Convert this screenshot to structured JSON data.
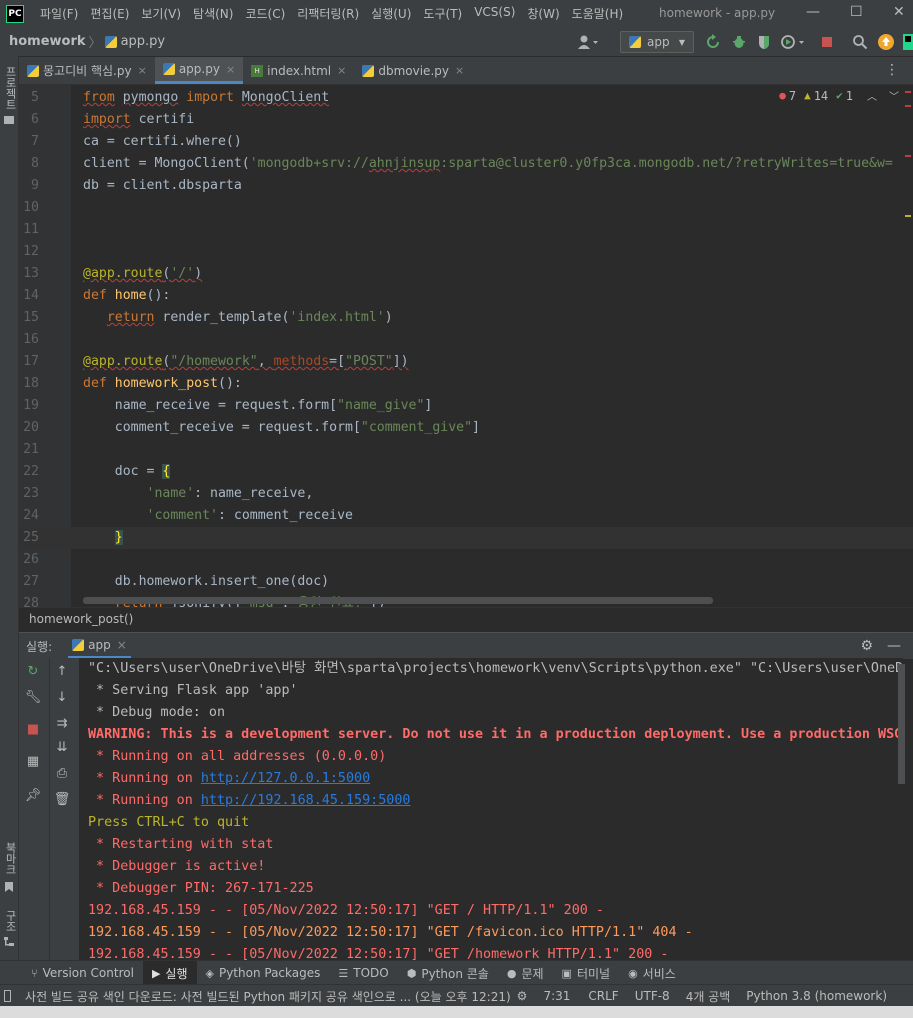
{
  "menubar": {
    "logo": "PC",
    "items": [
      "파일(F)",
      "편집(E)",
      "보기(V)",
      "탐색(N)",
      "코드(C)",
      "리팩터링(R)",
      "실행(U)",
      "도구(T)",
      "VCS(S)",
      "창(W)",
      "도움말(H)"
    ],
    "window_title": "homework - app.py",
    "minimize": "—",
    "maximize": "☐",
    "close": "✕"
  },
  "navbar": {
    "project": "homework",
    "separator": "〉",
    "file": "app.py",
    "run_config": "app",
    "run_config_arrow": "▼"
  },
  "left_stripe": {
    "project_label": "프로젝트",
    "bookmarks_label": "북마크",
    "structure_label": "구조"
  },
  "tabs": [
    {
      "label": "몽고디비 핵심.py",
      "icon": "python-file-icon",
      "active": false
    },
    {
      "label": "app.py",
      "icon": "python-file-icon",
      "active": true
    },
    {
      "label": "index.html",
      "icon": "html-file-icon",
      "active": false
    },
    {
      "label": "dbmovie.py",
      "icon": "python-file-icon",
      "active": false
    }
  ],
  "tab_close": "×",
  "tab_menu": "⋮",
  "inspections": {
    "errors": "7",
    "warnings": "14",
    "weak_warnings": "1"
  },
  "editor": {
    "lines": [
      {
        "n": "5",
        "html": "<span class='kw squig'>from</span> <span class='squig'>pymongo</span> <span class='kw'>import</span> <span class='squig'>MongoClient</span>"
      },
      {
        "n": "6",
        "html": "<span class='kw squig'>import</span> certifi"
      },
      {
        "n": "7",
        "html": "ca = certifi.where()"
      },
      {
        "n": "8",
        "html": "client = MongoClient(<span class='str'>'mongodb+srv://<span class='squig'>ahnjinsup</span>:sparta@cluster0.y0fp3ca.mongodb.net/?retryWrites=true&w=</span>"
      },
      {
        "n": "9",
        "html": "db = client.dbsparta"
      },
      {
        "n": "10",
        "html": ""
      },
      {
        "n": "11",
        "html": ""
      },
      {
        "n": "12",
        "html": ""
      },
      {
        "n": "13",
        "html": "<span class='dec squig'>@app.route</span><span class='squig'>(<span class='str'>'/'</span>)</span>"
      },
      {
        "n": "14",
        "html": "<span class='kw'>def</span> <span class='fn'>home</span>():"
      },
      {
        "n": "15",
        "html": "   <span class='kw squig'>return</span> render_template(<span class='str'>'index.html'</span>)"
      },
      {
        "n": "16",
        "html": ""
      },
      {
        "n": "17",
        "html": "<span class='dec squig'>@app.route</span><span class='squig'>(<span class='str'>\"/homework\"</span>, <span class='prm'>methods</span>=[<span class='str'>\"POST\"</span>])</span>"
      },
      {
        "n": "18",
        "html": "<span class='kw'>def</span> <span class='fn'>homework_post</span>():"
      },
      {
        "n": "19",
        "html": "    name_receive = request.form[<span class='str'>\"name_give\"</span>]"
      },
      {
        "n": "20",
        "html": "    comment_receive = request.form[<span class='str'>\"comment_give\"</span>]"
      },
      {
        "n": "21",
        "html": ""
      },
      {
        "n": "22",
        "html": "    doc = <span style='color:#ffef28;background:#3b514d'>{</span>"
      },
      {
        "n": "23",
        "html": "        <span class='str'>'name'</span>: name_receive,"
      },
      {
        "n": "24",
        "html": "        <span class='str'>'comment'</span>: comment_receive"
      },
      {
        "n": "25",
        "html": "    <span style='color:#ffef28;background:#3b514d'>}</span>"
      },
      {
        "n": "26",
        "html": ""
      },
      {
        "n": "27",
        "html": "    db.homework.insert_one(doc)"
      },
      {
        "n": "28",
        "html": "    <span class='kw'>return</span> jsonify({<span class='str'>'msg'</span>:<span class='str'>'응원 완료!'</span>})"
      }
    ],
    "current_line": "25"
  },
  "breadcrumb_footer": "homework_post()",
  "run_panel": {
    "label": "실행:",
    "tab": "app",
    "tab_close": "×",
    "console": [
      {
        "cls": "",
        "text": "\"C:\\Users\\user\\OneDrive\\바탕 화면\\sparta\\projects\\homework\\venv\\Scripts\\python.exe\" \"C:\\Users\\user\\OneDr"
      },
      {
        "cls": "",
        "text": " * Serving Flask app 'app'"
      },
      {
        "cls": "",
        "text": " * Debug mode: on"
      },
      {
        "cls": "err bold",
        "text": "WARNING: This is a development server. Do not use it in a production deployment. Use a production WSGI"
      },
      {
        "cls": "err",
        "text": " * Running on all addresses (0.0.0.0)"
      },
      {
        "cls": "err",
        "text": " * Running on ",
        "link": "http://127.0.0.1:5000"
      },
      {
        "cls": "err",
        "text": " * Running on ",
        "link": "http://192.168.45.159:5000"
      },
      {
        "cls": "warn",
        "text": "Press CTRL+C to quit"
      },
      {
        "cls": "err",
        "text": " * Restarting with stat"
      },
      {
        "cls": "err",
        "text": " * Debugger is active!"
      },
      {
        "cls": "err",
        "text": " * Debugger PIN: 267-171-225"
      },
      {
        "cls": "err",
        "text": "192.168.45.159 - - [05/Nov/2022 12:50:17] \"GET / HTTP/1.1\" 200 -"
      },
      {
        "cls": "warn2",
        "text": "192.168.45.159 - - [05/Nov/2022 12:50:17] \"GET /favicon.ico HTTP/1.1\" 404 -"
      },
      {
        "cls": "err",
        "text": "192.168.45.159 - - [05/Nov/2022 12:50:17] \"GET /homework HTTP/1.1\" 200 -"
      }
    ]
  },
  "tool_windows": [
    {
      "label": "Version Control",
      "icon": "branch-icon",
      "glyph": "⑂",
      "active": false
    },
    {
      "label": "실행",
      "icon": "run-icon",
      "glyph": "▶",
      "active": true
    },
    {
      "label": "Python Packages",
      "icon": "packages-icon",
      "glyph": "◈",
      "active": false
    },
    {
      "label": "TODO",
      "icon": "todo-icon",
      "glyph": "☰",
      "active": false
    },
    {
      "label": "Python 콘솔",
      "icon": "python-console-icon",
      "glyph": "⬢",
      "active": false
    },
    {
      "label": "문제",
      "icon": "problems-icon",
      "glyph": "●",
      "active": false
    },
    {
      "label": "터미널",
      "icon": "terminal-icon",
      "glyph": "▣",
      "active": false
    },
    {
      "label": "서비스",
      "icon": "services-icon",
      "glyph": "◉",
      "active": false
    }
  ],
  "statusbar": {
    "message": "사전 빌드 공유 색인 다운로드: 사전 빌드된 Python 패키지 공유 색인으로 ... (오늘 오후 12:21)",
    "position": "7:31",
    "line_sep": "CRLF",
    "encoding": "UTF-8",
    "indent": "4개 공백",
    "interpreter": "Python 3.8 (homework)"
  },
  "colors": {
    "accent": "#4a88c7",
    "error": "#ff6b68",
    "warning": "#bbb529"
  }
}
